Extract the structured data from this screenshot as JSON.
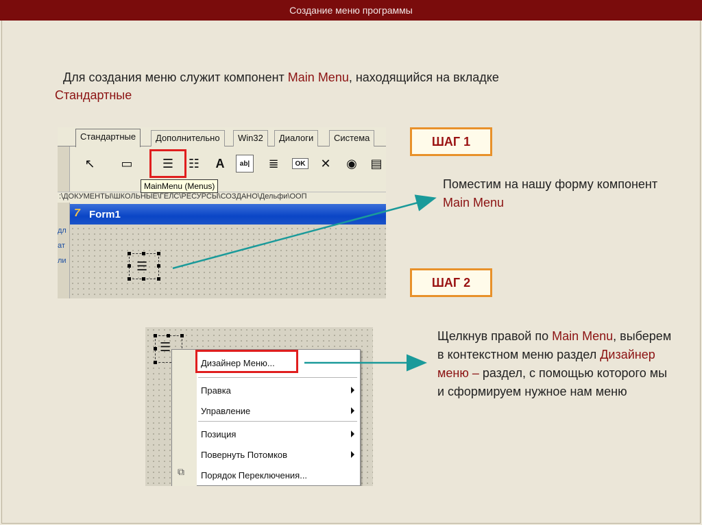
{
  "header": {
    "title": "Создание меню программы"
  },
  "intro": {
    "part1": "Для создания меню служит компонент ",
    "part2": "Main Menu",
    "part3": ", находящийся на вкладке",
    "part4": "Стандартные"
  },
  "ide": {
    "tabs": [
      "Стандартные",
      "Дополнительно",
      "Win32",
      "Диалоги",
      "Система"
    ],
    "tooltip": "MainMenu (Menus)",
    "path_text": ":\\ДОКУМЕНТЫ\\ШКОЛЬНЫЕ\\ГЕЛС\\РЕСУРСЫ\\СОЗДАНО\\Дельфи\\ООП",
    "form_title": "Form1",
    "form_logo": "7",
    "side_labels": [
      "дл",
      "ат",
      "ли"
    ],
    "palette_icons": [
      {
        "glyph": "↖",
        "icon": "pointer-icon"
      },
      {
        "glyph": "▭",
        "icon": "frame-icon"
      },
      {
        "glyph": "☰",
        "icon": "mainmenu-icon"
      },
      {
        "glyph": "☷",
        "icon": "popupmenu-icon"
      },
      {
        "glyph": "A",
        "icon": "label-icon"
      },
      {
        "glyph": "ab|",
        "icon": "edit-icon"
      },
      {
        "glyph": "≣",
        "icon": "memo-icon"
      },
      {
        "glyph": "OK",
        "icon": "button-icon"
      },
      {
        "glyph": "✕",
        "icon": "checkbox-icon"
      },
      {
        "glyph": "◉",
        "icon": "radiobutton-icon"
      },
      {
        "glyph": "▤",
        "icon": "listbox-icon"
      },
      {
        "glyph": "▥",
        "icon": "combobox-icon"
      }
    ]
  },
  "step1": {
    "label": "ШАГ 1",
    "text1": "Поместим на нашу форму компонент ",
    "text2": "Main Menu"
  },
  "step2": {
    "label": "ШАГ 2",
    "text1": "Щелкнув правой по ",
    "text2": "Main Menu",
    "text3": ", выберем в контекстном меню раздел ",
    "text4": "Дизайнер меню –",
    "text5": " раздел, с помощью которого мы и сформируем нужное нам меню"
  },
  "context_menu": {
    "items": [
      {
        "label": "Дизайнер Меню...",
        "submenu": false
      },
      {
        "label": "Правка",
        "submenu": true
      },
      {
        "label": "Управление",
        "submenu": true
      },
      {
        "label": "Позиция",
        "submenu": true
      },
      {
        "label": "Повернуть Потомков",
        "submenu": true
      },
      {
        "label": "Порядок Переключения...",
        "submenu": false
      }
    ]
  },
  "colors": {
    "header_bg": "#7a0c0c",
    "highlight": "#8b1212",
    "arrow": "#1a9a9a",
    "step_border": "#e8912a",
    "red_frame": "#e01e1e"
  }
}
